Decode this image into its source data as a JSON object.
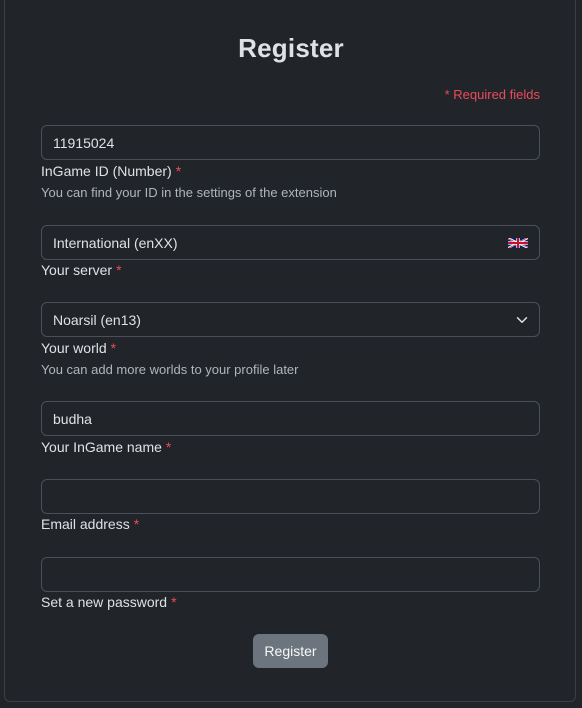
{
  "title": "Register",
  "required_note": "* Required fields",
  "fields": {
    "ingame_id": {
      "value": "11915024",
      "label": "InGame ID (Number)",
      "required": "*",
      "help": "You can find your ID in the settings of the extension"
    },
    "server": {
      "value": "International (enXX)",
      "label": "Your server",
      "required": "*",
      "icon": "uk-flag-icon"
    },
    "world": {
      "value": "Noarsil (en13)",
      "label": "Your world",
      "required": "*",
      "help": "You can add more worlds to your profile later",
      "icon": "chevron-down-icon"
    },
    "ingame_name": {
      "value": "budha",
      "label": "Your InGame name",
      "required": "*"
    },
    "email": {
      "value": "",
      "label": "Email address",
      "required": "*"
    },
    "password": {
      "value": "",
      "label": "Set a new password",
      "required": "*"
    }
  },
  "submit_label": "Register",
  "colors": {
    "background": "#212529",
    "required": "#ea4c5a",
    "button": "#6c757d",
    "border": "#495057"
  }
}
